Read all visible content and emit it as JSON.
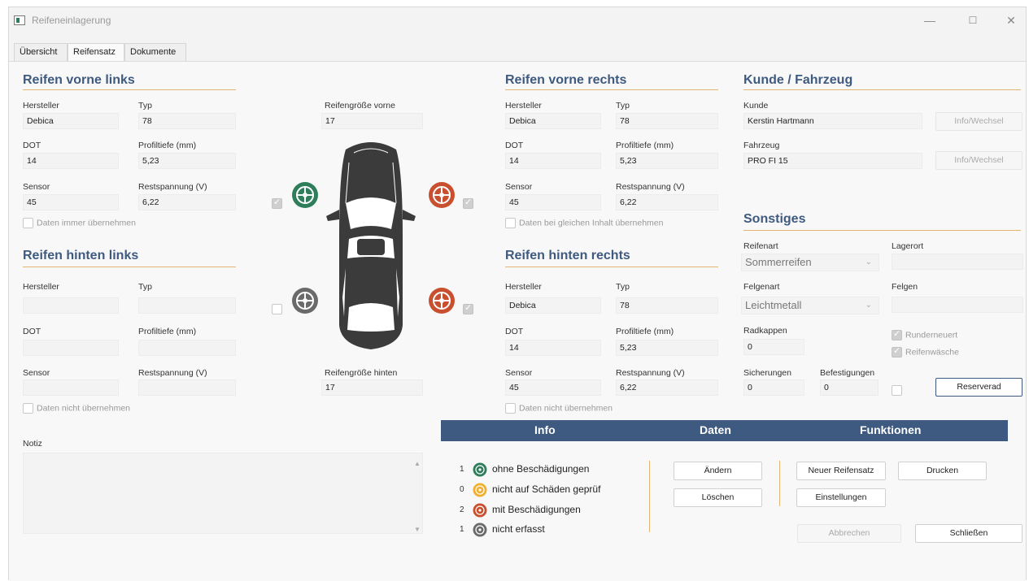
{
  "window": {
    "title": "Reifeneinlagerung",
    "min": "—",
    "max": "☐",
    "close": "✕"
  },
  "tabs": [
    {
      "label": "Übersicht"
    },
    {
      "label": "Reifensatz"
    },
    {
      "label": "Dokumente"
    }
  ],
  "vl": {
    "title": "Reifen vorne links",
    "hersteller_label": "Hersteller",
    "hersteller": "Debica",
    "typ_label": "Typ",
    "typ": "78",
    "dot_label": "DOT",
    "dot": "14",
    "profil_label": "Profiltiefe (mm)",
    "profil": "5,23",
    "sensor_label": "Sensor",
    "sensor": "45",
    "rest_label": "Restspannung (V)",
    "rest": "6,22",
    "check_label": "Daten immer übernehmen"
  },
  "hl": {
    "title": "Reifen hinten links",
    "hersteller_label": "Hersteller",
    "hersteller": "",
    "typ_label": "Typ",
    "typ": "",
    "dot_label": "DOT",
    "dot": "",
    "profil_label": "Profiltiefe (mm)",
    "profil": "",
    "sensor_label": "Sensor",
    "sensor": "",
    "rest_label": "Restspannung (V)",
    "rest": "",
    "check_label": "Daten nicht übernehmen"
  },
  "vr": {
    "title": "Reifen vorne rechts",
    "hersteller_label": "Hersteller",
    "hersteller": "Debica",
    "typ_label": "Typ",
    "typ": "78",
    "dot_label": "DOT",
    "dot": "14",
    "profil_label": "Profiltiefe (mm)",
    "profil": "5,23",
    "sensor_label": "Sensor",
    "sensor": "45",
    "rest_label": "Restspannung (V)",
    "rest": "6,22",
    "check_label": "Daten bei gleichen Inhalt übernehmen"
  },
  "hr": {
    "title": "Reifen hinten rechts",
    "hersteller_label": "Hersteller",
    "hersteller": "Debica",
    "typ_label": "Typ",
    "typ": "78",
    "dot_label": "DOT",
    "dot": "14",
    "profil_label": "Profiltiefe (mm)",
    "profil": "5,23",
    "sensor_label": "Sensor",
    "sensor": "45",
    "rest_label": "Restspannung (V)",
    "rest": "6,22",
    "check_label": "Daten nicht übernehmen"
  },
  "size": {
    "front_label": "Reifengröße vorne",
    "front": "17",
    "rear_label": "Reifengröße hinten",
    "rear": "17"
  },
  "colors": {
    "green": "#2e7d5b",
    "orange": "#f0b030",
    "red": "#c8502f",
    "gray": "#6a6a6a",
    "accent": "#3e5a80"
  },
  "kunde": {
    "title": "Kunde / Fahrzeug",
    "kunde_label": "Kunde",
    "kunde": "Kerstin Hartmann",
    "kunde_btn": "Info/Wechsel",
    "fahrzeug_label": "Fahrzeug",
    "fahrzeug": "PRO FI 15",
    "fahrzeug_btn": "Info/Wechsel"
  },
  "sonstiges": {
    "title": "Sonstiges",
    "reifenart_label": "Reifenart",
    "reifenart": "Sommerreifen",
    "lagerort_label": "Lagerort",
    "lagerort": "",
    "felgenart_label": "Felgenart",
    "felgenart": "Leichtmetall",
    "felgen_label": "Felgen",
    "felgen": "",
    "radkappen_label": "Radkappen",
    "radkappen": "0",
    "runderneuert_label": "Runderneuert",
    "reifenwaesche_label": "Reifenwäsche",
    "sicherungen_label": "Sicherungen",
    "sicherungen": "0",
    "befestigungen_label": "Befestigungen",
    "befestigungen": "0",
    "reserverad_btn": "Reserverad"
  },
  "infobar": {
    "info": "Info",
    "daten": "Daten",
    "funktionen": "Funktionen"
  },
  "legend": [
    {
      "count": "1",
      "label": "ohne Beschädigungen",
      "icon": "tire-green-icon"
    },
    {
      "count": "0",
      "label": "nicht auf Schäden geprüf",
      "icon": "tire-orange-icon"
    },
    {
      "count": "2",
      "label": "mit Beschädigungen",
      "icon": "tire-red-icon"
    },
    {
      "count": "1",
      "label": "nicht erfasst",
      "icon": "tire-gray-icon"
    }
  ],
  "buttons": {
    "aendern": "Ändern",
    "loeschen": "Löschen",
    "neuer_reifensatz": "Neuer Reifensatz",
    "drucken": "Drucken",
    "einstellungen": "Einstellungen",
    "abbrechen": "Abbrechen",
    "schliessen": "Schließen"
  },
  "notiz": {
    "label": "Notiz",
    "value": ""
  }
}
